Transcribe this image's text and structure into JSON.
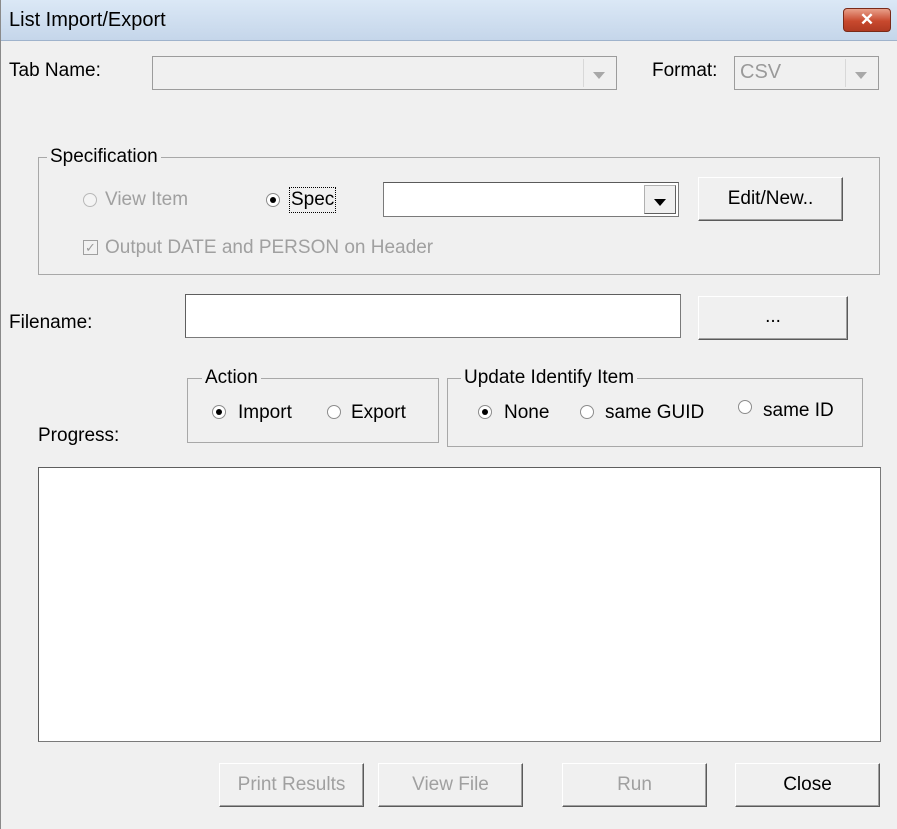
{
  "window": {
    "title": "List Import/Export",
    "close_glyph": "✕"
  },
  "tab_name": {
    "label": "Tab Name:",
    "value": ""
  },
  "format": {
    "label": "Format:",
    "value": "CSV"
  },
  "specification": {
    "legend": "Specification",
    "view_item_label": "View Item",
    "spec_label": "Spec",
    "spec_value": "",
    "edit_new_label": "Edit/New..",
    "output_header_label": "Output DATE and PERSON on Header"
  },
  "filename": {
    "label": "Filename:",
    "value": "",
    "browse_label": "..."
  },
  "action": {
    "legend": "Action",
    "import_label": "Import",
    "export_label": "Export"
  },
  "update": {
    "legend": "Update Identify Item",
    "none_label": "None",
    "guid_label": "same GUID",
    "id_label": "same ID"
  },
  "progress": {
    "label": "Progress:"
  },
  "buttons": {
    "print_results": "Print Results",
    "view_file": "View File",
    "run": "Run",
    "close": "Close"
  }
}
